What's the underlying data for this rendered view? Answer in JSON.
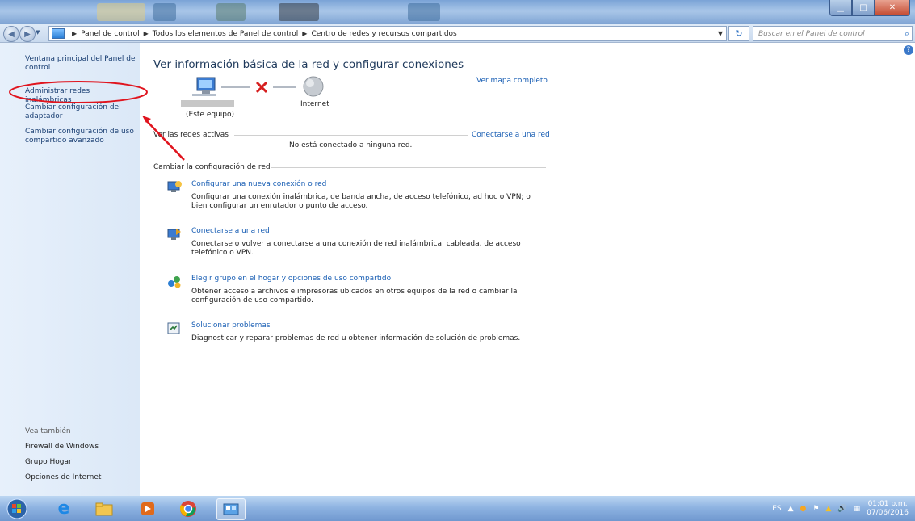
{
  "address": {
    "crumbs": [
      "Panel de control",
      "Todos los elementos de Panel de control",
      "Centro de redes y recursos compartidos"
    ],
    "search_placeholder": "Buscar en el Panel de control"
  },
  "sidebar": {
    "links": [
      "Ventana principal del Panel de control",
      "Administrar redes inalámbricas",
      "Cambiar configuración del adaptador",
      "Cambiar configuración de uso compartido avanzado"
    ],
    "see_also_label": "Vea también",
    "see_also": [
      "Firewall de Windows",
      "Grupo Hogar",
      "Opciones de Internet"
    ]
  },
  "main": {
    "title": "Ver información básica de la red y configurar conexiones",
    "view_full_map": "Ver mapa completo",
    "this_computer": "(Este equipo)",
    "internet": "Internet",
    "active_networks_label": "Ver las redes activas",
    "connect_to_network": "Conectarse a una red",
    "not_connected": "No está conectado a ninguna red.",
    "change_settings_label": "Cambiar la configuración de red",
    "tasks": [
      {
        "title": "Configurar una nueva conexión o red",
        "desc": "Configurar una conexión inalámbrica, de banda ancha, de acceso telefónico, ad hoc o VPN; o bien configurar un enrutador o punto de acceso.",
        "icon": "new-connection-icon"
      },
      {
        "title": "Conectarse a una red",
        "desc": "Conectarse o volver a conectarse a una conexión de red inalámbrica, cableada, de acceso telefónico o VPN.",
        "icon": "connect-network-icon"
      },
      {
        "title": "Elegir grupo en el hogar y opciones de uso compartido",
        "desc": "Obtener acceso a archivos e impresoras ubicados en otros equipos de la red o cambiar la configuración de uso compartido.",
        "icon": "homegroup-icon"
      },
      {
        "title": "Solucionar problemas",
        "desc": "Diagnosticar y reparar problemas de red u obtener información de solución de problemas.",
        "icon": "troubleshoot-icon"
      }
    ]
  },
  "taskbar": {
    "language": "ES",
    "time": "01:01 p.m.",
    "date": "07/06/2016"
  },
  "colors": {
    "link": "#1a5fb4",
    "annotation": "#e0141e",
    "sidebar_bg": "#dbe8f7"
  }
}
